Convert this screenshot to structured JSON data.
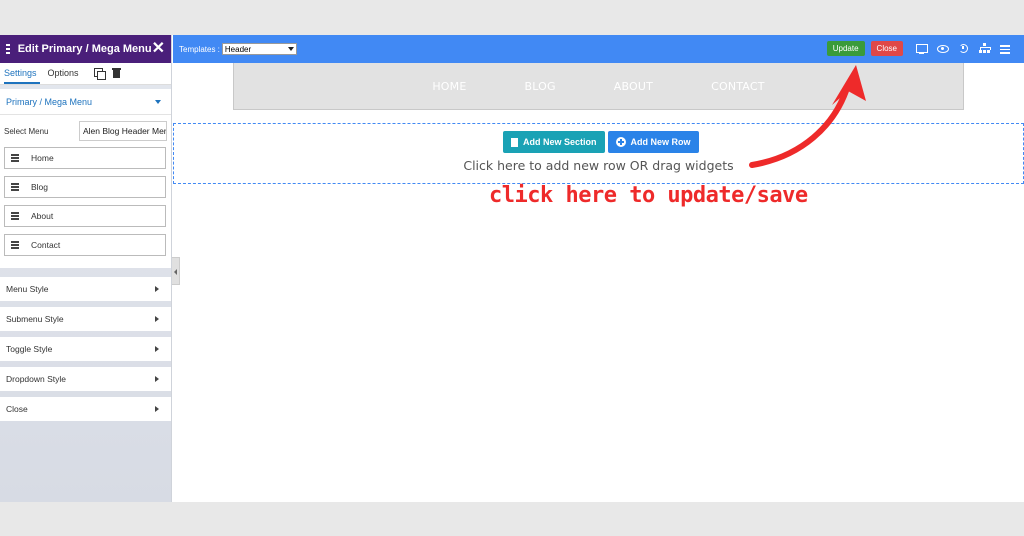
{
  "sidebar": {
    "title": "Edit Primary / Mega Menu",
    "tabs": [
      "Settings",
      "Options"
    ],
    "section_title": "Primary / Mega Menu",
    "select_menu_label": "Select Menu",
    "select_menu_value": "Alen Blog Header Menu",
    "menu_items": [
      "Home",
      "Blog",
      "About",
      "Contact"
    ],
    "accordions": [
      "Menu Style",
      "Submenu Style",
      "Toggle Style",
      "Dropdown Style",
      "Close"
    ]
  },
  "toolbar": {
    "templates_label": "Templates :",
    "templates_value": "Header",
    "update_label": "Update",
    "close_label": "Close",
    "icons": [
      "monitor-icon",
      "eye-icon",
      "history-icon",
      "sitemap-icon",
      "menu-icon"
    ],
    "color": "#4189f4"
  },
  "nav_preview": {
    "links": [
      "HOME",
      "BLOG",
      "ABOUT",
      "CONTACT"
    ]
  },
  "dropzone": {
    "add_section_label": "Add New Section",
    "add_row_label": "Add New Row",
    "hint": "Click here to add new row OR drag widgets"
  },
  "annotation": {
    "text": "click here to update/save",
    "color": "#ee2a2a"
  }
}
